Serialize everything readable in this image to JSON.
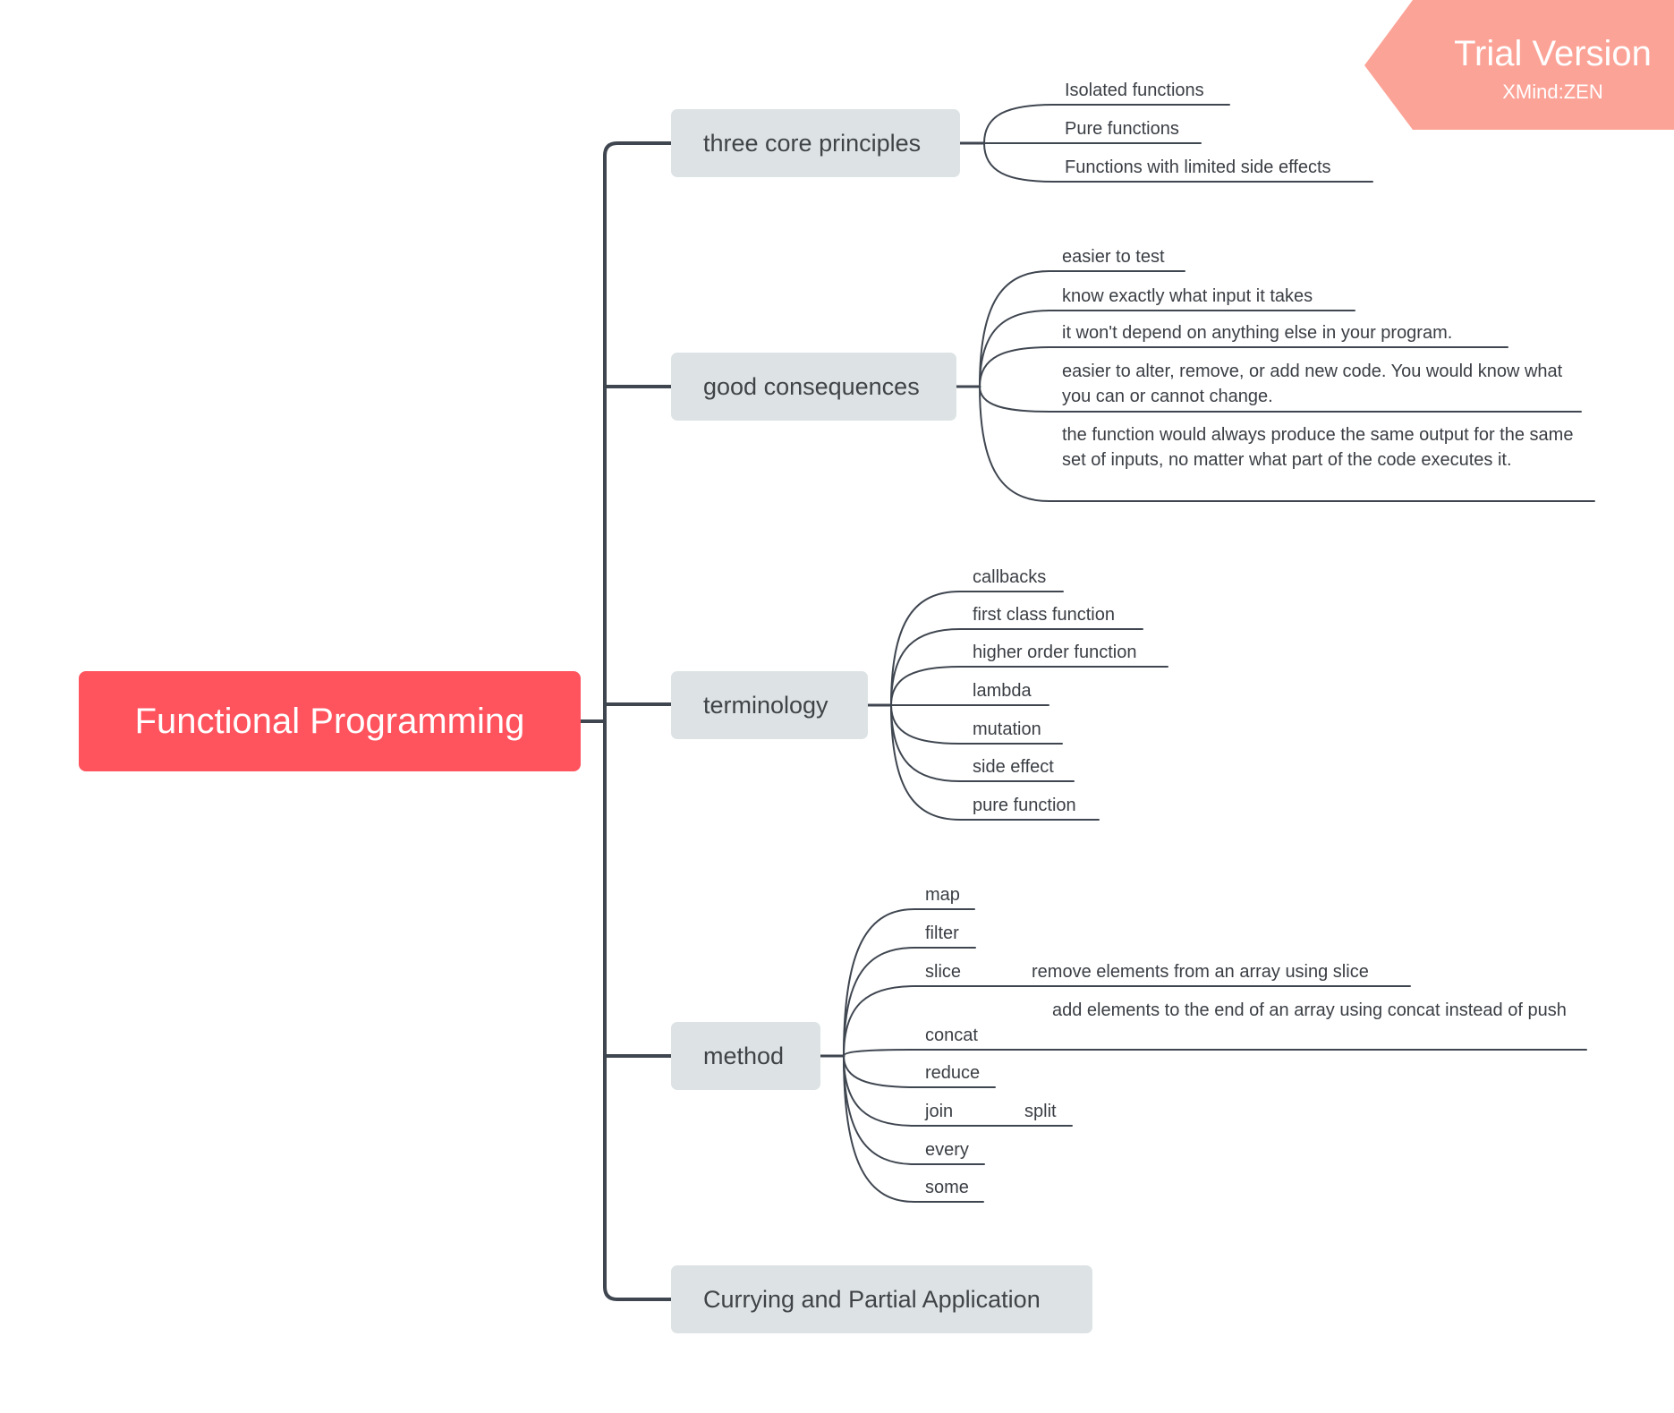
{
  "watermark": {
    "title": "Trial Version",
    "subtitle": "XMind:ZEN",
    "color": "#FCA397"
  },
  "colors": {
    "root": "#FF535E",
    "topic": "#DDE3E4",
    "line": "#3F4650"
  },
  "root": {
    "label": "Functional Programming"
  },
  "topics": [
    {
      "label": "three core principles",
      "children": [
        {
          "label": "Isolated functions"
        },
        {
          "label": "Pure functions"
        },
        {
          "label": "Functions with limited side effects"
        }
      ]
    },
    {
      "label": "good consequences",
      "children": [
        {
          "label": "easier to test"
        },
        {
          "label": "know exactly what input it takes"
        },
        {
          "label": "it won't depend on anything else in your program."
        },
        {
          "label": "easier to alter, remove, or add new code. You would know what you can or cannot change."
        },
        {
          "label": "the function would always produce the same output for the same set of inputs, no matter what part of the code executes it."
        }
      ]
    },
    {
      "label": "terminology",
      "children": [
        {
          "label": "callbacks"
        },
        {
          "label": "first class function"
        },
        {
          "label": "higher order function"
        },
        {
          "label": "lambda"
        },
        {
          "label": "mutation"
        },
        {
          "label": "side effect"
        },
        {
          "label": "pure function"
        }
      ]
    },
    {
      "label": "method",
      "children": [
        {
          "label": "map"
        },
        {
          "label": "filter"
        },
        {
          "label": "slice",
          "detail": "remove elements from an array using slice"
        },
        {
          "label": "concat",
          "detail": "add elements to the end of an array using concat instead of push"
        },
        {
          "label": "reduce"
        },
        {
          "label": "join",
          "detail": "split"
        },
        {
          "label": "every"
        },
        {
          "label": "some"
        }
      ]
    },
    {
      "label": "Currying and Partial Application",
      "children": []
    }
  ]
}
